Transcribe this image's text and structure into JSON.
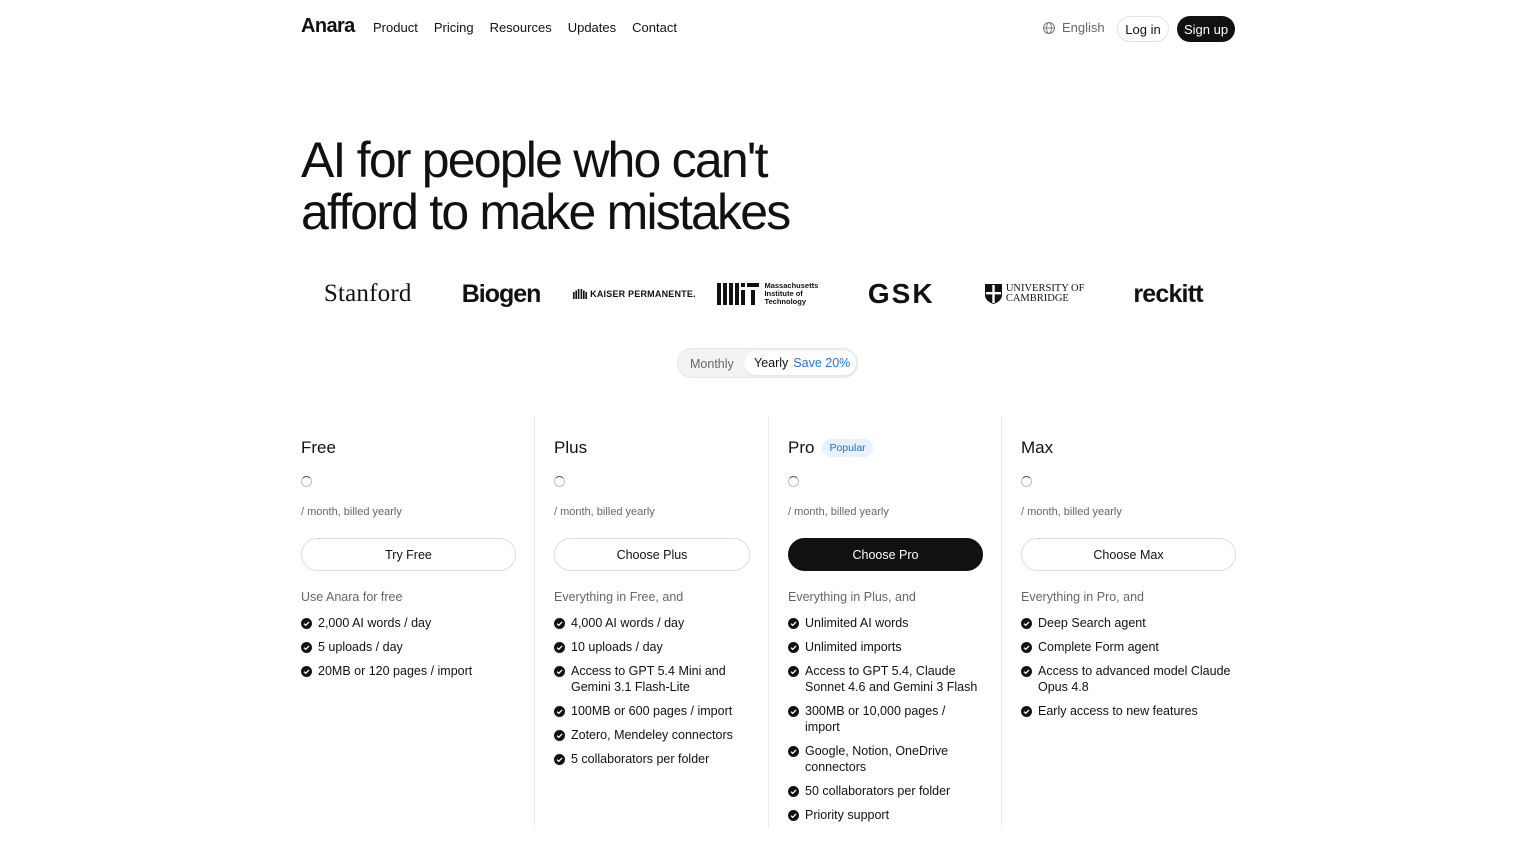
{
  "nav": {
    "logo": "Anara",
    "links": [
      "Product",
      "Pricing",
      "Resources",
      "Updates",
      "Contact"
    ],
    "language": "English",
    "login": "Log in",
    "signup": "Sign up"
  },
  "hero": {
    "line1": "AI for people who can't",
    "line2": "afford to make mistakes"
  },
  "logos": {
    "stanford": "Stanford",
    "biogen": "Biogen",
    "kaiser": "KAISER PERMANENTE.",
    "mit_line1": "Massachusetts",
    "mit_line2": "Institute of",
    "mit_line3": "Technology",
    "gsk": "GSK",
    "cambridge_line1": "UNIVERSITY OF",
    "cambridge_line2": "CAMBRIDGE",
    "reckitt": "reckitt"
  },
  "billing_toggle": {
    "monthly": "Monthly",
    "yearly": "Yearly",
    "save": "Save 20%",
    "selected": "Yearly"
  },
  "plans": [
    {
      "name": "Free",
      "badge": "",
      "billing": "/ month, billed yearly",
      "cta": "Try Free",
      "lead": "Use Anara for free",
      "features": [
        "2,000 AI words / day",
        "5 uploads / day",
        "20MB or 120 pages / import"
      ]
    },
    {
      "name": "Plus",
      "badge": "",
      "billing": "/ month, billed yearly",
      "cta": "Choose Plus",
      "lead": "Everything in Free, and",
      "features": [
        "4,000 AI words / day",
        "10 uploads / day",
        "Access to GPT 5.4 Mini and Gemini 3.1 Flash-Lite",
        "100MB or 600 pages / import",
        "Zotero, Mendeley connectors",
        "5 collaborators per folder"
      ]
    },
    {
      "name": "Pro",
      "badge": "Popular",
      "billing": "/ month, billed yearly",
      "cta": "Choose Pro",
      "lead": "Everything in Plus, and",
      "features": [
        "Unlimited AI words",
        "Unlimited imports",
        "Access to GPT 5.4, Claude Sonnet 4.6 and Gemini 3 Flash",
        "300MB or 10,000 pages / import",
        "Google, Notion, OneDrive connectors",
        "50 collaborators per folder",
        "Priority support"
      ]
    },
    {
      "name": "Max",
      "badge": "",
      "billing": "/ month, billed yearly",
      "cta": "Choose Max",
      "lead": "Everything in Pro, and",
      "features": [
        "Deep Search agent",
        "Complete Form agent",
        "Access to advanced model Claude Opus 4.8",
        "Early access to new features"
      ]
    }
  ],
  "colors": {
    "accent_blue": "#1d76d8",
    "primary_dark": "#111111",
    "muted_text": "#666666"
  }
}
